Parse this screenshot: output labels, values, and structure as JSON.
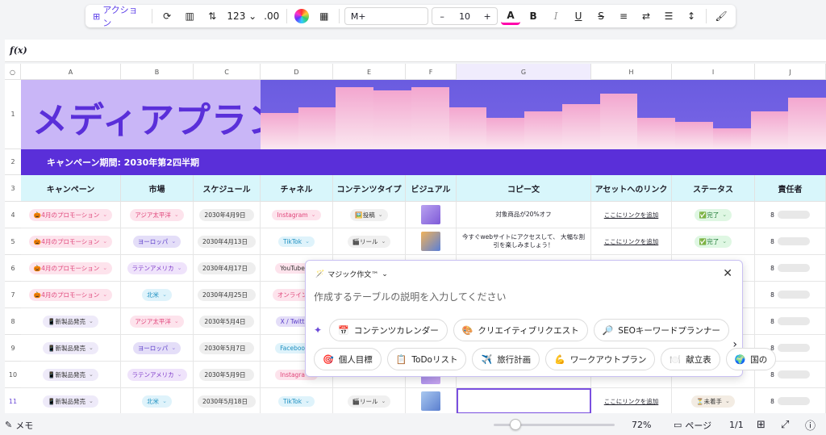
{
  "toolbar": {
    "action_label": "アクション",
    "number_format": "123",
    "decimal": ".00",
    "font": "M+",
    "font_size": "10",
    "minus": "–",
    "plus": "+"
  },
  "formula_bar": {
    "fx": "f(x)"
  },
  "columns": [
    "A",
    "B",
    "C",
    "D",
    "E",
    "F",
    "G",
    "H",
    "I",
    "J"
  ],
  "rows": [
    "1",
    "2",
    "3",
    "4",
    "5",
    "6",
    "7",
    "8",
    "9",
    "10",
    "11"
  ],
  "banner": {
    "title": "メディアプラン"
  },
  "period": "キャンペーン期間: 2030年第2四半期",
  "headers": [
    "キャンペーン",
    "市場",
    "スケジュール",
    "チャネル",
    "コンテンツタイプ",
    "ビジュアル",
    "コピー文",
    "アセットへのリンク",
    "ステータス",
    "責任者"
  ],
  "data_rows": [
    {
      "campaign": "🎃4月のプロモーション",
      "market": "アジア太平洋",
      "date": "2030年4月9日",
      "channel": "Instagram",
      "type": "🖼️投稿",
      "copy": "対象商品が20%オフ",
      "link": "ここにリンクを追加",
      "status": "✅完了",
      "owner": "8"
    },
    {
      "campaign": "🎃4月のプロモーション",
      "market": "ヨーロッパ",
      "date": "2030年4月13日",
      "channel": "TikTok",
      "type": "🎬リール",
      "copy": "今すぐwebサイトにアクセスして、 大幅な割引を楽しみましょう！",
      "link": "ここにリンクを追加",
      "status": "✅完了",
      "owner": "8"
    },
    {
      "campaign": "🎃4月のプロモーション",
      "market": "ラテンアメリカ",
      "date": "2030年4月17日",
      "channel": "YouTube",
      "type": "",
      "copy": "",
      "link": "",
      "status": "",
      "owner": "8"
    },
    {
      "campaign": "🎃4月のプロモーション",
      "market": "北米",
      "date": "2030年4月25日",
      "channel": "オンライン",
      "type": "",
      "copy": "",
      "link": "",
      "status": "",
      "owner": "8"
    },
    {
      "campaign": "📱新製品発売",
      "market": "アジア太平洋",
      "date": "2030年5月4日",
      "channel": "X / Twitt",
      "type": "",
      "copy": "",
      "link": "",
      "status": "",
      "owner": "8"
    },
    {
      "campaign": "📱新製品発売",
      "market": "ヨーロッパ",
      "date": "2030年5月7日",
      "channel": "Faceboo",
      "type": "",
      "copy": "",
      "link": "",
      "status": "",
      "owner": "8"
    },
    {
      "campaign": "📱新製品発売",
      "market": "ラテンアメリカ",
      "date": "2030年5月9日",
      "channel": "Instagra",
      "type": "",
      "copy": "",
      "link": "",
      "status": "",
      "owner": "8"
    },
    {
      "campaign": "📱新製品発売",
      "market": "北米",
      "date": "2030年5月18日",
      "channel": "TikTok",
      "type": "🎬リール",
      "copy": "",
      "link": "ここにリンクを追加",
      "status": "⏳未着手",
      "owner": "8"
    }
  ],
  "magic": {
    "title": "マジック作文™",
    "placeholder": "作成するテーブルの説明を入力してください",
    "row1": [
      {
        "icon": "📅",
        "label": "コンテンツカレンダー"
      },
      {
        "icon": "🎨",
        "label": "クリエイティブリクエスト"
      },
      {
        "icon": "🔎",
        "label": "SEOキーワードプランナー"
      }
    ],
    "row2": [
      {
        "icon": "🎯",
        "label": "個人目標"
      },
      {
        "icon": "📋",
        "label": "ToDoリスト"
      },
      {
        "icon": "✈️",
        "label": "旅行計画"
      },
      {
        "icon": "💪",
        "label": "ワークアウトプラン"
      },
      {
        "icon": "🍽️",
        "label": "献立表"
      },
      {
        "icon": "🌍",
        "label": "国の"
      }
    ]
  },
  "status": {
    "memo": "メモ",
    "zoom": "72%",
    "page_label": "ページ",
    "page_count": "1/1"
  }
}
